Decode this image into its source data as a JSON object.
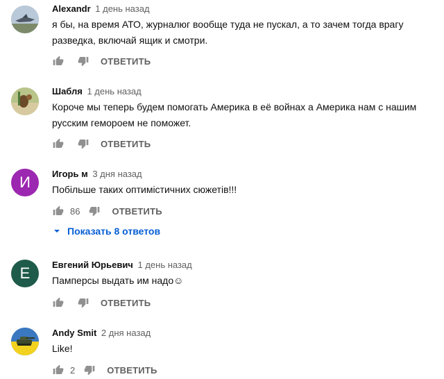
{
  "colors": {
    "avatar_igor": "#9c27b0",
    "avatar_evgeniy": "#1f5b4a",
    "link_blue": "#065fd4",
    "meta_gray": "#606060"
  },
  "comments": [
    {
      "author": "Alexandr",
      "time": "1 день назад",
      "text": "я бы, на время АТО, журналюг вообще туда не пускал, а то зачем тогда врагу разведка, включай ящик и смотри.",
      "likes": "",
      "reply": "ОТВЕТИТЬ",
      "avatar_letter": ""
    },
    {
      "author": "Шабля",
      "time": "1 день назад",
      "text": "Короче мы теперь будем помогать Америка в её войнах а Америка нам с нашим русским геморoем не поможет.",
      "likes": "",
      "reply": "ОТВЕТИТЬ",
      "avatar_letter": ""
    },
    {
      "author": "Игорь м",
      "time": "3 дня назад",
      "text": "Побільше таких оптимістичних сюжетів!!!",
      "likes": "86",
      "reply": "ОТВЕТИТЬ",
      "avatar_letter": "И"
    },
    {
      "author": "Евгений Юрьевич",
      "time": "1 день назад",
      "text": "Памперсы выдать им надо☺",
      "likes": "",
      "reply": "ОТВЕТИТЬ",
      "avatar_letter": "Е"
    },
    {
      "author": "Andy Smit",
      "time": "2 дня назад",
      "text": "Like!",
      "likes": "2",
      "reply": "ОТВЕТИТЬ",
      "avatar_letter": ""
    }
  ],
  "show_replies": "Показать 8 ответов"
}
